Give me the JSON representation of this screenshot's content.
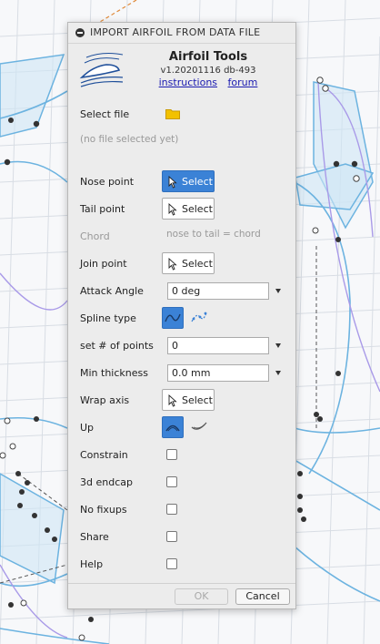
{
  "dialog": {
    "title": "IMPORT AIRFOIL FROM DATA FILE",
    "brand": "Airfoil Tools",
    "version": "v1.20201116 db-493",
    "links": {
      "instructions": "instructions",
      "forum": "forum"
    },
    "colors": {
      "accent": "#3b82d6",
      "panel": "#ececec",
      "link": "#1a1ab0",
      "muted": "#999999"
    }
  },
  "file": {
    "label": "Select file",
    "status": "(no file selected yet)",
    "icon": "folder-icon"
  },
  "rows": {
    "nose": {
      "label": "Nose point",
      "button": "Select",
      "active": true
    },
    "tail": {
      "label": "Tail point",
      "button": "Select"
    },
    "chord": {
      "label": "Chord",
      "hint": "nose to tail = chord"
    },
    "join": {
      "label": "Join point",
      "button": "Select"
    },
    "attack": {
      "label": "Attack Angle",
      "value": "0 deg"
    },
    "spline": {
      "label": "Spline type",
      "options": [
        "spline-curve-icon",
        "control-points-icon"
      ],
      "selected": 0
    },
    "points": {
      "label": "set # of points",
      "value": "0"
    },
    "thickness": {
      "label": "Min thickness",
      "value": "0.0 mm"
    },
    "wrap": {
      "label": "Wrap axis",
      "button": "Select"
    },
    "up": {
      "label": "Up",
      "options": [
        "arc-up-icon",
        "arc-down-icon"
      ],
      "selected": 0
    },
    "constrain": {
      "label": "Constrain",
      "checked": false
    },
    "endcap": {
      "label": "3d endcap",
      "checked": false
    },
    "fixups": {
      "label": "No fixups",
      "checked": false
    },
    "share": {
      "label": "Share",
      "checked": false
    },
    "help": {
      "label": "Help",
      "checked": false
    }
  },
  "footer": {
    "ok": "OK",
    "cancel": "Cancel",
    "ok_enabled": false
  }
}
